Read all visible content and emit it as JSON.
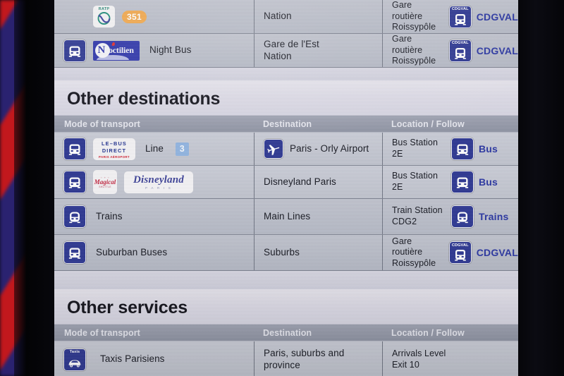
{
  "meta": {
    "screen_kind": "airport-departure-information-panel",
    "accent_follow_color": "#2733a0",
    "pictogram_color": "#2b3590",
    "badge_orange": "#f0a64a",
    "badge_blue": "#8fb3e0"
  },
  "columns": {
    "mode": "Mode of transport",
    "destination": "Destination",
    "location": "Location / Follow"
  },
  "top_rows": [
    {
      "pictogram": "bus-icon",
      "pictogram_visible": false,
      "operator_logo": "ratp-logo",
      "operator_logo_text": "RATP",
      "badge": "351",
      "badge_style": "orange",
      "mode_label": "",
      "destination": "Nation",
      "location": "Gare routière\nRoissypôle",
      "location_line1": "Gare routière",
      "location_line2": "Roissypôle",
      "follow_icon": "cdgval-train-icon",
      "follow_icon_caption": "CDGVAL",
      "follow": "CDGVAL"
    },
    {
      "pictogram": "bus-icon",
      "pictogram_visible": true,
      "operator_logo": "noctilien-logo",
      "operator_logo_text": "Noctilien",
      "badge": "",
      "badge_style": "",
      "mode_label": "Night Bus",
      "destination_line1": "Gare de l'Est",
      "destination_line2": "Nation",
      "location_line1": "Gare routière",
      "location_line2": "Roissypôle",
      "follow_icon": "cdgval-train-icon",
      "follow_icon_caption": "CDGVAL",
      "follow": "CDGVAL"
    }
  ],
  "sections": [
    {
      "id": "other-destinations",
      "title": "Other destinations",
      "rows": [
        {
          "pictogram": "bus-icon",
          "operator_logo": "le-bus-direct-logo",
          "operator_logo_line1": "LE–BUS",
          "operator_logo_line2": "DIRECT",
          "operator_logo_line3": "PARIS AÉROPORT",
          "mode_label": "Line",
          "badge": "3",
          "badge_style": "blue-square",
          "destination_icon": "airplane-icon",
          "destination": "Paris - Orly Airport",
          "location_line1": "Bus Station",
          "location_line2": "2E",
          "follow_icon": "bus-icon",
          "follow": "Bus"
        },
        {
          "pictogram": "bus-icon",
          "operator_logo": "magical-shuttle-logo",
          "operator_logo_text": "Magical",
          "operator_logo_2": "disneyland-paris-logo",
          "operator_logo_2_text": "Disneyland",
          "operator_logo_2_sub": "P A R I S",
          "mode_label": "",
          "destination": "Disneyland Paris",
          "location_line1": "Bus Station",
          "location_line2": "2E",
          "follow_icon": "bus-icon",
          "follow": "Bus"
        },
        {
          "pictogram": "train-icon",
          "mode_label": "Trains",
          "destination": "Main Lines",
          "location_line1": "Train Station",
          "location_line2": "CDG2",
          "follow_icon": "train-icon",
          "follow": "Trains"
        },
        {
          "pictogram": "bus-icon",
          "mode_label": "Suburban Buses",
          "destination": "Suburbs",
          "location_line1": "Gare routière",
          "location_line2": "Roissypôle",
          "follow_icon": "cdgval-train-icon",
          "follow_icon_caption": "CDGVAL",
          "follow": "CDGVAL"
        }
      ]
    },
    {
      "id": "other-services",
      "title": "Other services",
      "rows": [
        {
          "pictogram": "taxi-icon",
          "pictogram_caption": "Taxis",
          "mode_label": "Taxis Parisiens",
          "destination": "Paris, suburbs and province",
          "location_line1": "Arrivals Level",
          "location_line2": "Exit 10",
          "follow": ""
        }
      ]
    }
  ]
}
